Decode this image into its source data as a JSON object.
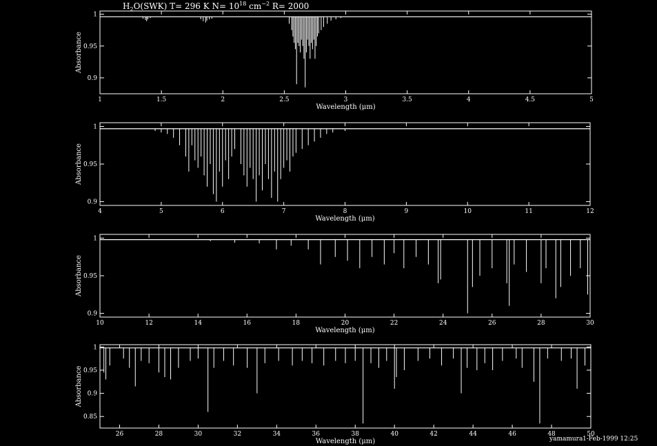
{
  "title": {
    "species": "H",
    "species_sub": "2",
    "species_rest": "O(SWK)",
    "temp_text": " T= 296 K N= 10",
    "n_exp": "18",
    "unit": " cm",
    "unit_exp": "−2",
    "res_text": " R= 2000"
  },
  "footer": {
    "user": "yamamura",
    "date": "1-Feb-1999 12:25"
  },
  "colors": {
    "background": "#000000",
    "foreground": "#ffffff"
  },
  "chart_data": [
    {
      "type": "line",
      "xlabel": "Wavelength (μm)",
      "ylabel": "Absorbance",
      "xlim": [
        1,
        5
      ],
      "ylim": [
        0.875,
        1.005
      ],
      "xticks": [
        1,
        1.5,
        2,
        2.5,
        3,
        3.5,
        4,
        4.5,
        5
      ],
      "xtick_labels": [
        "1",
        "1.5",
        "2",
        "2.5",
        "3",
        "3.5",
        "4",
        "4.5",
        "5"
      ],
      "yticks": [
        0.9,
        0.95,
        1
      ],
      "ytick_labels": [
        "0.9",
        "0.95",
        "1"
      ],
      "continuum": 0.996,
      "lines": [
        [
          1.35,
          0.993
        ],
        [
          1.37,
          0.991
        ],
        [
          1.38,
          0.989
        ],
        [
          1.39,
          0.992
        ],
        [
          1.41,
          0.994
        ],
        [
          1.82,
          0.992
        ],
        [
          1.84,
          0.989
        ],
        [
          1.86,
          0.987
        ],
        [
          1.87,
          0.99
        ],
        [
          1.89,
          0.992
        ],
        [
          1.91,
          0.993
        ],
        [
          2.54,
          0.985
        ],
        [
          2.56,
          0.975
        ],
        [
          2.57,
          0.965
        ],
        [
          2.58,
          0.955
        ],
        [
          2.59,
          0.945
        ],
        [
          2.6,
          0.89
        ],
        [
          2.61,
          0.955
        ],
        [
          2.62,
          0.95
        ],
        [
          2.63,
          0.94
        ],
        [
          2.64,
          0.96
        ],
        [
          2.65,
          0.95
        ],
        [
          2.66,
          0.93
        ],
        [
          2.67,
          0.885
        ],
        [
          2.68,
          0.94
        ],
        [
          2.69,
          0.96
        ],
        [
          2.7,
          0.95
        ],
        [
          2.71,
          0.93
        ],
        [
          2.72,
          0.955
        ],
        [
          2.73,
          0.945
        ],
        [
          2.74,
          0.96
        ],
        [
          2.75,
          0.93
        ],
        [
          2.76,
          0.95
        ],
        [
          2.77,
          0.965
        ],
        [
          2.78,
          0.97
        ],
        [
          2.8,
          0.975
        ],
        [
          2.82,
          0.98
        ],
        [
          2.85,
          0.985
        ],
        [
          2.88,
          0.99
        ],
        [
          2.92,
          0.992
        ],
        [
          2.96,
          0.994
        ]
      ]
    },
    {
      "type": "line",
      "xlabel": "Wavelength (μm)",
      "ylabel": "Absorbance",
      "xlim": [
        4,
        12
      ],
      "ylim": [
        0.895,
        1.005
      ],
      "xticks": [
        4,
        5,
        6,
        7,
        8,
        9,
        10,
        11,
        12
      ],
      "xtick_labels": [
        "4",
        "5",
        "6",
        "7",
        "8",
        "9",
        "10",
        "11",
        "12"
      ],
      "yticks": [
        0.9,
        0.95,
        1
      ],
      "ytick_labels": [
        "0.9",
        "0.95",
        "1"
      ],
      "continuum": 0.997,
      "lines": [
        [
          4.9,
          0.994
        ],
        [
          5.0,
          0.992
        ],
        [
          5.1,
          0.99
        ],
        [
          5.2,
          0.985
        ],
        [
          5.3,
          0.975
        ],
        [
          5.4,
          0.96
        ],
        [
          5.45,
          0.94
        ],
        [
          5.5,
          0.975
        ],
        [
          5.55,
          0.955
        ],
        [
          5.6,
          0.945
        ],
        [
          5.65,
          0.96
        ],
        [
          5.7,
          0.935
        ],
        [
          5.75,
          0.92
        ],
        [
          5.8,
          0.95
        ],
        [
          5.85,
          0.91
        ],
        [
          5.9,
          0.9
        ],
        [
          5.95,
          0.94
        ],
        [
          6.0,
          0.92
        ],
        [
          6.05,
          0.955
        ],
        [
          6.1,
          0.93
        ],
        [
          6.15,
          0.96
        ],
        [
          6.2,
          0.97
        ],
        [
          6.3,
          0.95
        ],
        [
          6.35,
          0.935
        ],
        [
          6.4,
          0.92
        ],
        [
          6.45,
          0.945
        ],
        [
          6.5,
          0.93
        ],
        [
          6.55,
          0.9
        ],
        [
          6.6,
          0.935
        ],
        [
          6.65,
          0.915
        ],
        [
          6.7,
          0.95
        ],
        [
          6.75,
          0.93
        ],
        [
          6.8,
          0.905
        ],
        [
          6.85,
          0.94
        ],
        [
          6.9,
          0.9
        ],
        [
          6.95,
          0.93
        ],
        [
          7.0,
          0.945
        ],
        [
          7.05,
          0.955
        ],
        [
          7.1,
          0.94
        ],
        [
          7.15,
          0.96
        ],
        [
          7.2,
          0.965
        ],
        [
          7.3,
          0.97
        ],
        [
          7.4,
          0.975
        ],
        [
          7.5,
          0.98
        ],
        [
          7.6,
          0.985
        ],
        [
          7.7,
          0.99
        ],
        [
          7.8,
          0.992
        ],
        [
          8.0,
          0.994
        ]
      ]
    },
    {
      "type": "line",
      "xlabel": "Wavelength (μm)",
      "ylabel": "Absorbance",
      "xlim": [
        10,
        30
      ],
      "ylim": [
        0.895,
        1.005
      ],
      "xticks": [
        10,
        12,
        14,
        16,
        18,
        20,
        22,
        24,
        26,
        28,
        30
      ],
      "xtick_labels": [
        "10",
        "12",
        "14",
        "16",
        "18",
        "20",
        "22",
        "24",
        "26",
        "28",
        "30"
      ],
      "yticks": [
        0.9,
        0.95,
        1
      ],
      "ytick_labels": [
        "0.9",
        "0.95",
        "1"
      ],
      "continuum": 0.998,
      "lines": [
        [
          14.5,
          0.996
        ],
        [
          15.5,
          0.994
        ],
        [
          16.5,
          0.993
        ],
        [
          17.2,
          0.985
        ],
        [
          17.8,
          0.99
        ],
        [
          18.5,
          0.985
        ],
        [
          19.0,
          0.965
        ],
        [
          19.6,
          0.975
        ],
        [
          20.1,
          0.97
        ],
        [
          20.6,
          0.96
        ],
        [
          21.1,
          0.975
        ],
        [
          21.6,
          0.965
        ],
        [
          22.0,
          0.98
        ],
        [
          22.4,
          0.96
        ],
        [
          22.9,
          0.975
        ],
        [
          23.4,
          0.965
        ],
        [
          23.8,
          0.94
        ],
        [
          23.9,
          0.945
        ],
        [
          25.0,
          0.9
        ],
        [
          25.2,
          0.935
        ],
        [
          25.5,
          0.95
        ],
        [
          26.0,
          0.96
        ],
        [
          26.6,
          0.94
        ],
        [
          26.7,
          0.91
        ],
        [
          26.9,
          0.965
        ],
        [
          27.4,
          0.955
        ],
        [
          28.0,
          0.94
        ],
        [
          28.2,
          0.96
        ],
        [
          28.6,
          0.92
        ],
        [
          28.8,
          0.935
        ],
        [
          29.2,
          0.95
        ],
        [
          29.6,
          0.96
        ],
        [
          29.9,
          0.925
        ]
      ]
    },
    {
      "type": "line",
      "xlabel": "Wavelength (μm)",
      "ylabel": "Absorbance",
      "xlim": [
        25,
        50
      ],
      "ylim": [
        0.825,
        1.005
      ],
      "xticks": [
        26,
        28,
        30,
        32,
        34,
        36,
        38,
        40,
        42,
        44,
        46,
        48,
        50
      ],
      "xtick_labels": [
        "26",
        "28",
        "30",
        "32",
        "34",
        "36",
        "38",
        "40",
        "42",
        "44",
        "46",
        "48",
        "50"
      ],
      "yticks": [
        0.85,
        0.9,
        0.95,
        1
      ],
      "ytick_labels": [
        "0.85",
        "0.9",
        "0.95",
        "1"
      ],
      "continuum": 0.998,
      "lines": [
        [
          25.2,
          0.945
        ],
        [
          25.3,
          0.93
        ],
        [
          25.5,
          0.96
        ],
        [
          26.2,
          0.975
        ],
        [
          26.5,
          0.955
        ],
        [
          26.8,
          0.915
        ],
        [
          27.1,
          0.97
        ],
        [
          27.5,
          0.965
        ],
        [
          28.0,
          0.945
        ],
        [
          28.3,
          0.935
        ],
        [
          28.6,
          0.93
        ],
        [
          29.0,
          0.955
        ],
        [
          29.6,
          0.97
        ],
        [
          30.0,
          0.975
        ],
        [
          30.5,
          0.86
        ],
        [
          30.8,
          0.955
        ],
        [
          31.3,
          0.97
        ],
        [
          31.8,
          0.96
        ],
        [
          32.5,
          0.955
        ],
        [
          33.0,
          0.9
        ],
        [
          33.4,
          0.965
        ],
        [
          34.1,
          0.97
        ],
        [
          34.8,
          0.96
        ],
        [
          35.3,
          0.97
        ],
        [
          35.8,
          0.965
        ],
        [
          36.4,
          0.96
        ],
        [
          37.0,
          0.97
        ],
        [
          37.5,
          0.965
        ],
        [
          38.0,
          0.97
        ],
        [
          38.4,
          0.835
        ],
        [
          38.8,
          0.965
        ],
        [
          39.2,
          0.955
        ],
        [
          39.6,
          0.97
        ],
        [
          40.0,
          0.91
        ],
        [
          40.1,
          0.935
        ],
        [
          40.5,
          0.95
        ],
        [
          41.2,
          0.97
        ],
        [
          41.8,
          0.975
        ],
        [
          42.4,
          0.96
        ],
        [
          43.0,
          0.975
        ],
        [
          43.4,
          0.9
        ],
        [
          43.7,
          0.955
        ],
        [
          44.2,
          0.95
        ],
        [
          44.6,
          0.965
        ],
        [
          45.0,
          0.95
        ],
        [
          45.5,
          0.97
        ],
        [
          46.2,
          0.975
        ],
        [
          46.5,
          0.955
        ],
        [
          47.1,
          0.925
        ],
        [
          47.4,
          0.835
        ],
        [
          47.8,
          0.975
        ],
        [
          48.5,
          0.97
        ],
        [
          49.0,
          0.975
        ],
        [
          49.3,
          0.91
        ],
        [
          49.7,
          0.96
        ]
      ]
    }
  ]
}
